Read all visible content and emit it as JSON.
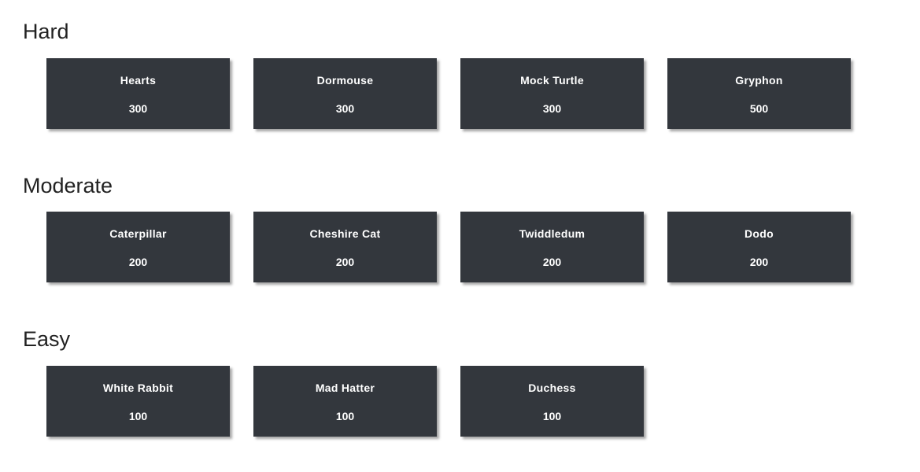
{
  "sections": [
    {
      "title": "Hard",
      "challenges": [
        {
          "name": "Hearts",
          "points": "300"
        },
        {
          "name": "Dormouse",
          "points": "300"
        },
        {
          "name": "Mock Turtle",
          "points": "300"
        },
        {
          "name": "Gryphon",
          "points": "500"
        }
      ]
    },
    {
      "title": "Moderate",
      "challenges": [
        {
          "name": "Caterpillar",
          "points": "200"
        },
        {
          "name": "Cheshire Cat",
          "points": "200"
        },
        {
          "name": "Twiddledum",
          "points": "200"
        },
        {
          "name": "Dodo",
          "points": "200"
        }
      ]
    },
    {
      "title": "Easy",
      "challenges": [
        {
          "name": "White Rabbit",
          "points": "100"
        },
        {
          "name": "Mad Hatter",
          "points": "100"
        },
        {
          "name": "Duchess",
          "points": "100"
        }
      ]
    }
  ],
  "colors": {
    "card_background": "#33373d",
    "card_text": "#ffffff",
    "heading_text": "#222222"
  }
}
